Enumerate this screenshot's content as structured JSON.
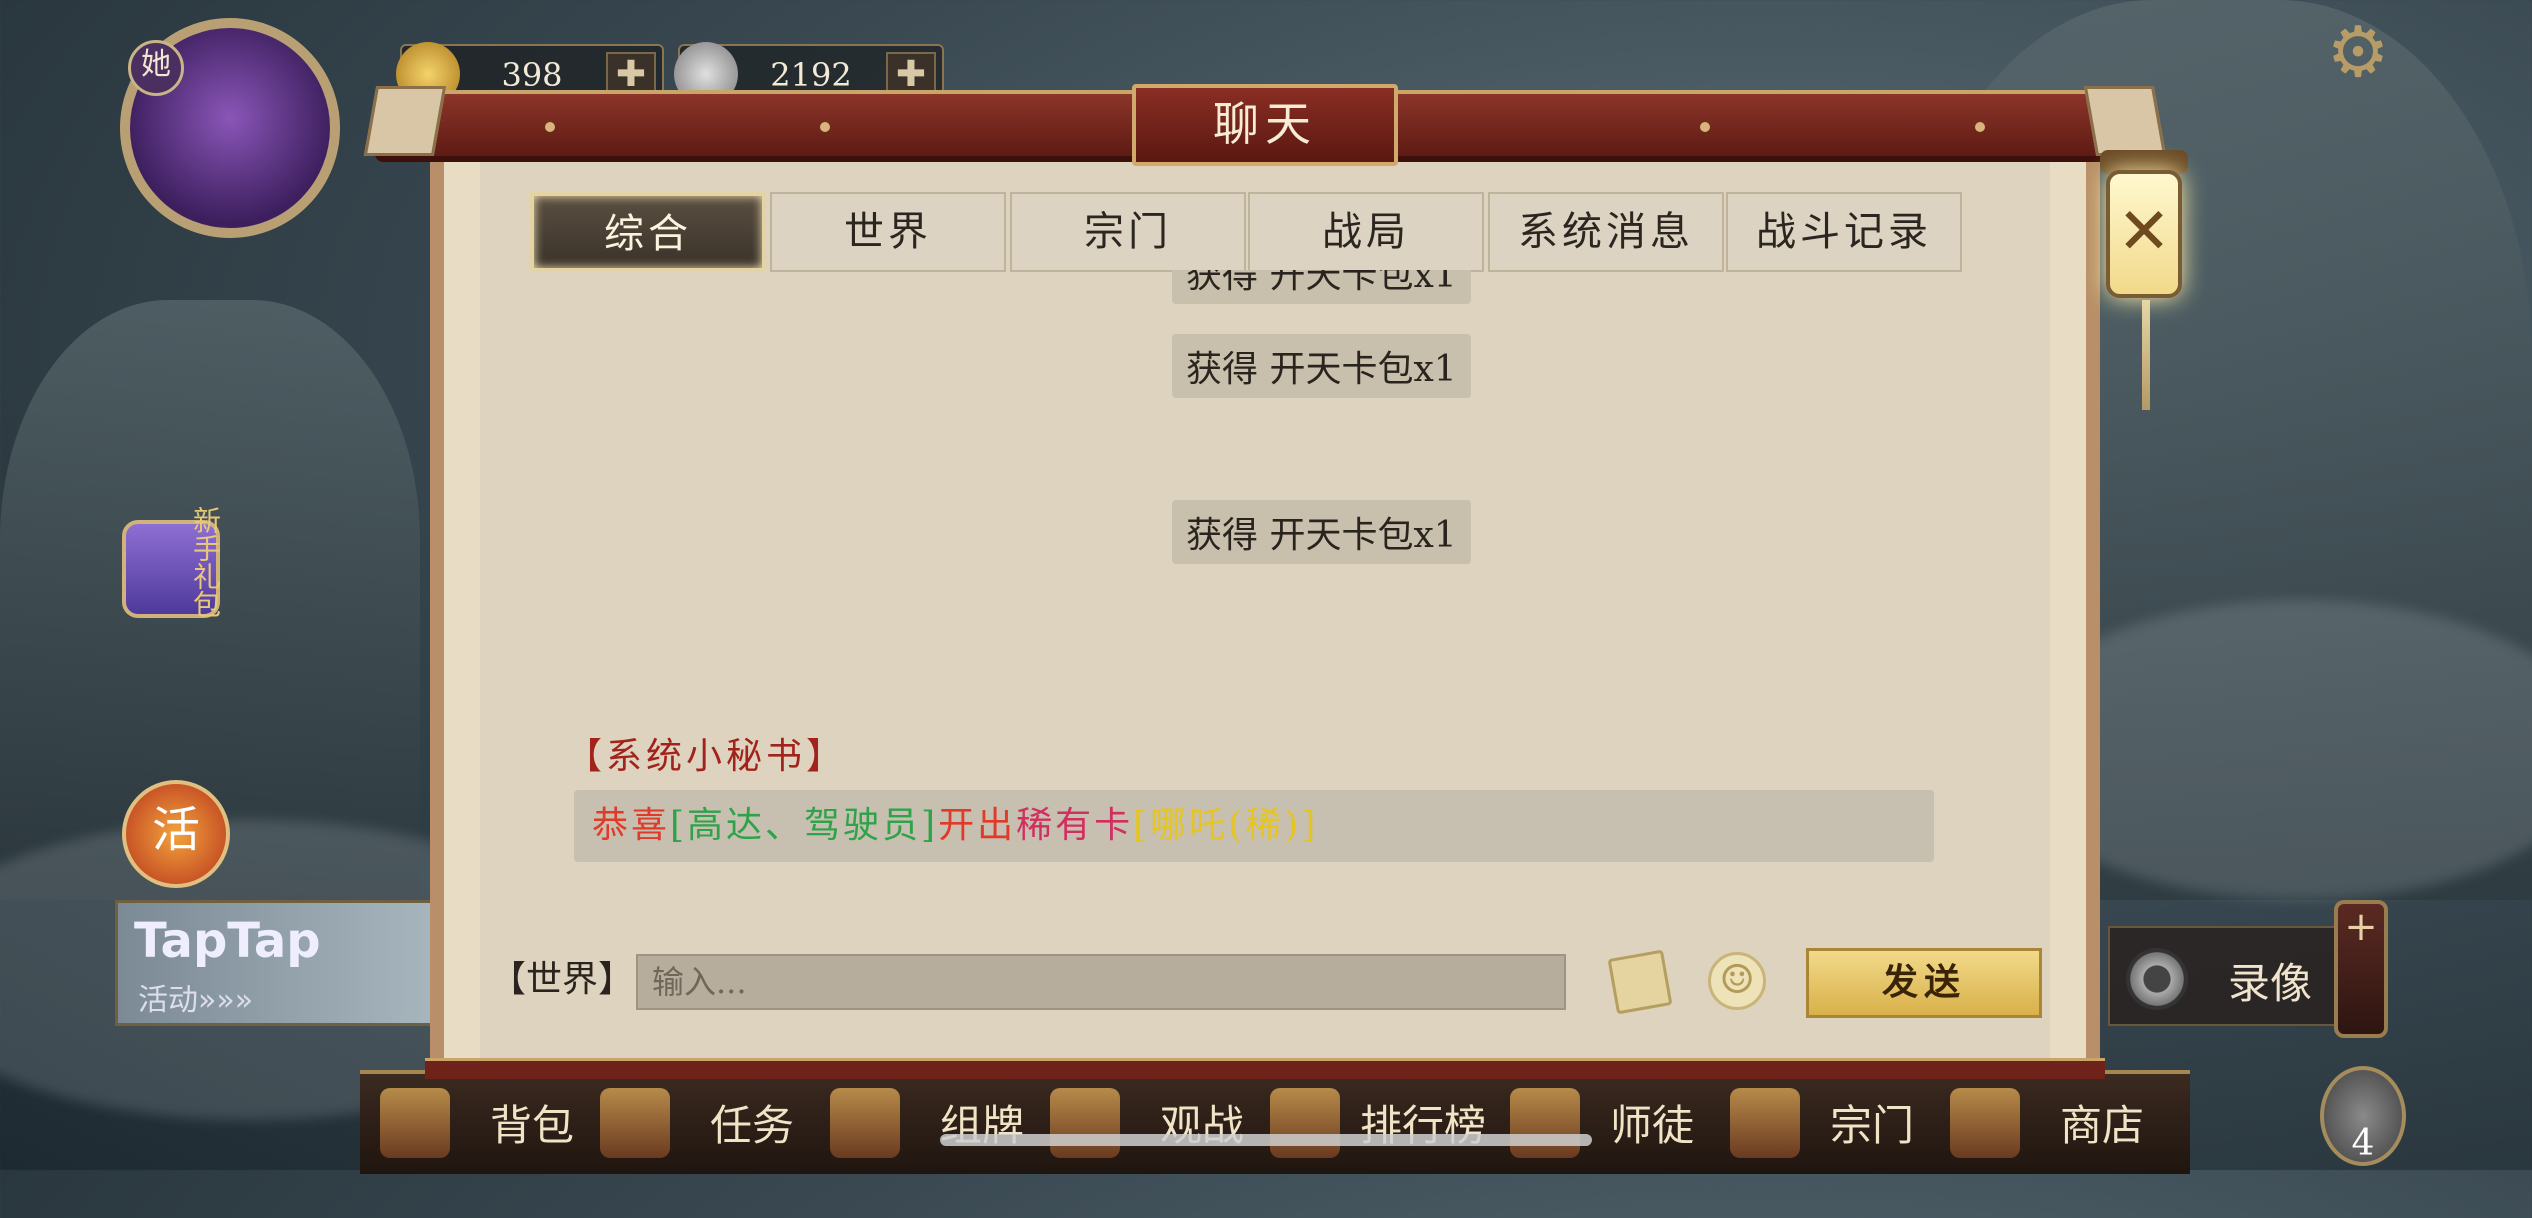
{
  "hud": {
    "avatar_tag": "她",
    "currency_gold": "398",
    "currency_silver": "2192",
    "gift_label": "新手礼包",
    "activity_label": "活",
    "taptap_title": "TapTap",
    "taptap_sub": "活动»»»",
    "record_label": "录像",
    "plus_symbol": "+",
    "badge_count": "4"
  },
  "dialog": {
    "title": "聊天",
    "close_symbol": "✕",
    "tabs": [
      {
        "label": "综合",
        "active": true
      },
      {
        "label": "世界",
        "active": false
      },
      {
        "label": "宗门",
        "active": false
      },
      {
        "label": "战局",
        "active": false
      },
      {
        "label": "系统消息",
        "active": false
      },
      {
        "label": "战斗记录",
        "active": false
      }
    ],
    "messages": {
      "reward_1": "获得 开天卡包x1",
      "reward_2": "获得 开天卡包x1",
      "reward_3": "获得 开天卡包x1",
      "sender": "【系统小秘书】",
      "sys_part1": "恭喜",
      "sys_part2": "[高达、驾驶员]",
      "sys_part3": "开出",
      "sys_part4": "稀有卡",
      "sys_part5": "[哪吒(稀)]"
    },
    "input": {
      "channel": "【世界】",
      "placeholder": "输入...",
      "send_label": "发送"
    }
  },
  "bottom_nav": {
    "items": [
      "背包",
      "任务",
      "组牌",
      "观战",
      "排行榜",
      "师徒",
      "宗门",
      "商店"
    ]
  },
  "colors": {
    "panel": "#e9dcc4",
    "title_bar": "#8c3529",
    "send_button": "#f2d98a",
    "highlight_red": "#e03a2a",
    "highlight_green": "#2fa34a",
    "highlight_yellow": "#e6c520"
  }
}
